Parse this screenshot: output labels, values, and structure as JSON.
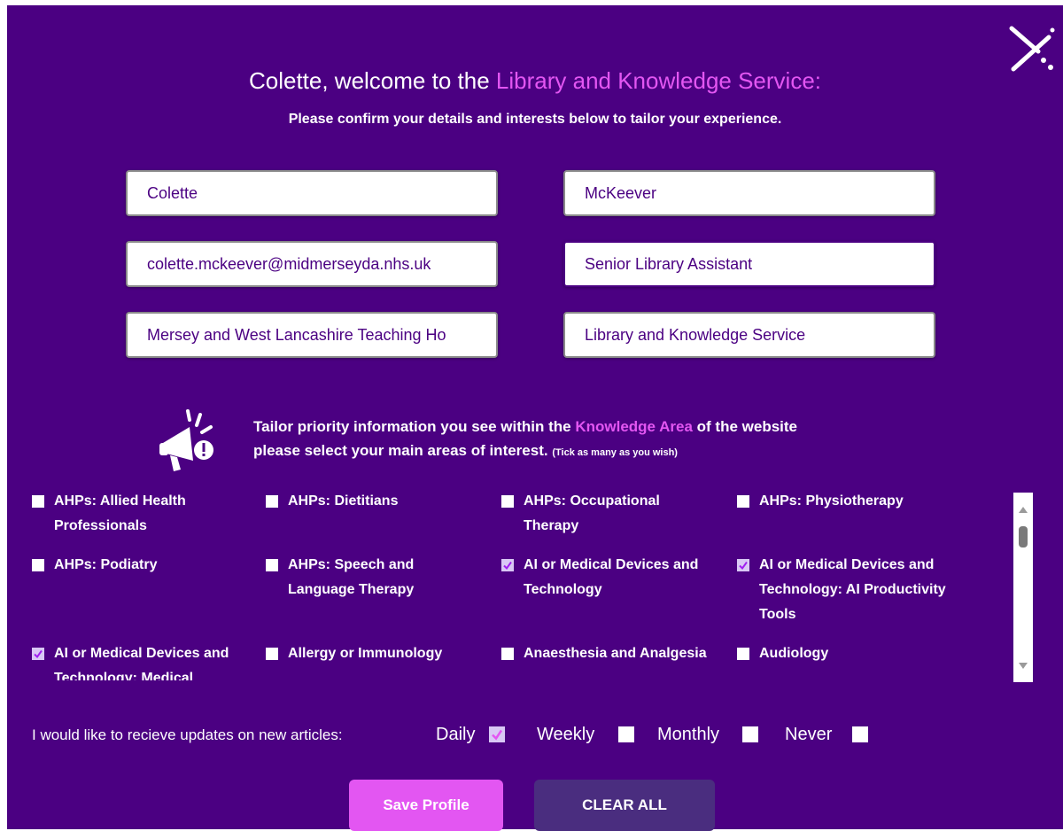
{
  "header": {
    "greeting": "Colette, welcome to the",
    "service_name": "Library and Knowledge Service:",
    "subtitle": "Please confirm your details and interests below to tailor your experience."
  },
  "form": {
    "first_name": "Colette",
    "last_name": "McKeever",
    "email": "colette.mckeever@midmerseyda.nhs.uk",
    "job_title": "Senior Library Assistant",
    "organisation": "Mersey and West Lancashire Teaching Ho",
    "department": "Library and Knowledge Service"
  },
  "interests_intro": {
    "line1_prefix": "Tailor priority information you see within the",
    "line1_link": "Knowledge Area",
    "line1_suffix": "of the website",
    "line2": "please select your main areas of interest.",
    "hint": "(Tick as many as you wish)"
  },
  "interests": [
    {
      "label": "AHPs: Allied Health Professionals",
      "checked": false
    },
    {
      "label": "AHPs: Dietitians",
      "checked": false
    },
    {
      "label": "AHPs: Occupational Therapy",
      "checked": false
    },
    {
      "label": "AHPs: Physiotherapy",
      "checked": false
    },
    {
      "label": "AHPs: Podiatry",
      "checked": false
    },
    {
      "label": "AHPs: Speech and Language Therapy",
      "checked": false
    },
    {
      "label": "AI or Medical Devices and Technology",
      "checked": true
    },
    {
      "label": "AI or Medical Devices and Technology: AI Productivity Tools",
      "checked": true
    },
    {
      "label": "AI or Medical Devices and Technology: Medical",
      "checked": true
    },
    {
      "label": "Allergy or Immunology",
      "checked": false
    },
    {
      "label": "Anaesthesia and Analgesia",
      "checked": false
    },
    {
      "label": "Audiology",
      "checked": false
    }
  ],
  "updates": {
    "label": "I would like to recieve updates on new articles:",
    "options": [
      {
        "label": "Daily",
        "checked": true
      },
      {
        "label": "Weekly",
        "checked": false
      },
      {
        "label": "Monthly",
        "checked": false
      },
      {
        "label": "Never",
        "checked": false
      }
    ]
  },
  "buttons": {
    "save": "Save Profile",
    "clear": "CLEAR ALL"
  },
  "colors": {
    "background": "#4b0082",
    "accent": "#e356f2",
    "clear_button": "#4a2d7f"
  },
  "icons": {
    "close": "close-x-icon",
    "announcement": "megaphone-icon"
  }
}
